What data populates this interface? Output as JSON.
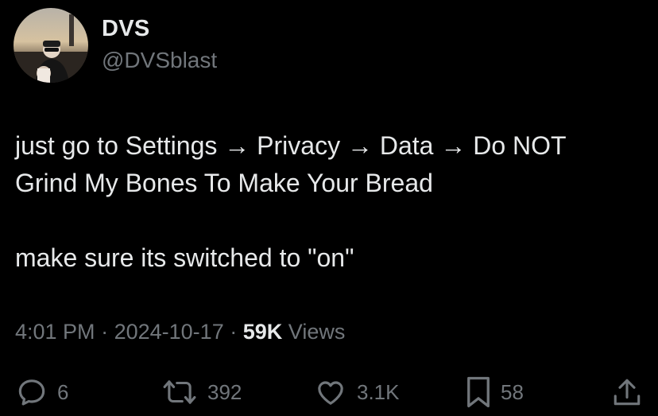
{
  "author": {
    "display_name": "DVS",
    "handle": "@DVSblast",
    "avatar_icon": "profile-photo"
  },
  "tweet": {
    "lines": [
      "just go to Settings → Privacy → Data → Do NOT",
      "Grind My Bones To Make Your Bread",
      "make sure its switched to \"on\""
    ]
  },
  "meta": {
    "time": "4:01 PM",
    "separator": "·",
    "date": "2024-10-17",
    "views_count": "59K",
    "views_label": "Views"
  },
  "actions": {
    "reply_count": "6",
    "retweet_count": "392",
    "like_count": "3.1K",
    "bookmark_count": "58",
    "icons": [
      "reply-icon",
      "retweet-icon",
      "like-icon",
      "bookmark-icon",
      "share-icon"
    ]
  },
  "colors": {
    "background": "#000000",
    "primary_text": "#e7e9ea",
    "secondary_text": "#71767b"
  }
}
